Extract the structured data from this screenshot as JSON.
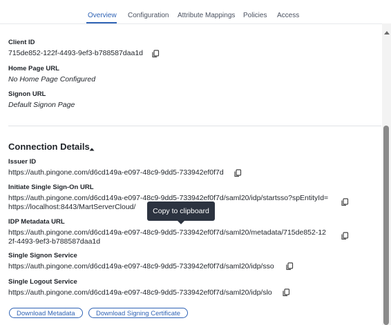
{
  "tabs": [
    {
      "label": "Overview",
      "active": true
    },
    {
      "label": "Configuration",
      "active": false
    },
    {
      "label": "Attribute Mappings",
      "active": false
    },
    {
      "label": "Policies",
      "active": false
    },
    {
      "label": "Access",
      "active": false
    }
  ],
  "general": {
    "client_id_label": "Client ID",
    "client_id_value": "715de852-122f-4493-9ef3-b788587daa1d",
    "home_page_label": "Home Page URL",
    "home_page_value": "No Home Page Configured",
    "signon_label": "Signon URL",
    "signon_value": "Default Signon Page"
  },
  "connection": {
    "title": "Connection Details",
    "issuer_id_label": "Issuer ID",
    "issuer_id_value": "https://auth.pingone.com/d6cd149a-e097-48c9-9dd5-733942ef0f7d",
    "initiate_sso_label": "Initiate Single Sign-On URL",
    "initiate_sso_line1": "https://auth.pingone.com/d6cd149a-e097-48c9-9dd5-733942ef0f7d/saml20/idp/startsso?spEntityId=",
    "initiate_sso_line2": "https://localhost:8443/MartServerCloud/",
    "idp_metadata_label": "IDP Metadata URL",
    "idp_metadata_line1": "https://auth.pingone.com/d6cd149a-e097-48c9-9dd5-733942ef0f7d/saml20/metadata/715de852-12",
    "idp_metadata_line2": "2f-4493-9ef3-b788587daa1d",
    "signon_service_label": "Single Signon Service",
    "signon_service_value": "https://auth.pingone.com/d6cd149a-e097-48c9-9dd5-733942ef0f7d/saml20/idp/sso",
    "logout_service_label": "Single Logout Service",
    "logout_service_value": "https://auth.pingone.com/d6cd149a-e097-48c9-9dd5-733942ef0f7d/saml20/idp/slo"
  },
  "tooltip": {
    "text": "Copy to clipboard"
  },
  "buttons": {
    "download_metadata": "Download Metadata",
    "download_certificate": "Download Signing Certificate"
  },
  "colors": {
    "accent": "#2f63b5",
    "tooltip_bg": "#2c3340"
  }
}
